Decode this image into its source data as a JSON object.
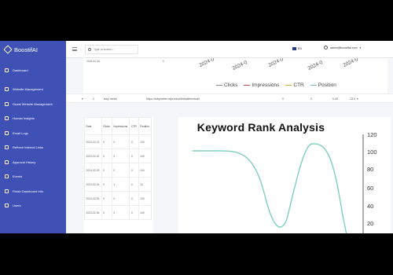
{
  "sidebar": {
    "brand": "BoostifAI",
    "items": [
      {
        "label": "Dashboard",
        "icon": "home-icon"
      },
      {
        "label": "Website Management",
        "icon": "globe-icon"
      },
      {
        "label": "Guest Website Management",
        "icon": "users-icon"
      },
      {
        "label": "Human Insights",
        "icon": "chart-icon"
      },
      {
        "label": "Email Logs",
        "icon": "mail-icon"
      },
      {
        "label": "Refresh Internal Links",
        "icon": "link-icon"
      },
      {
        "label": "Approval History",
        "icon": "check-icon"
      },
      {
        "label": "Events",
        "icon": "calendar-icon"
      },
      {
        "label": "Finish Dashboard Info",
        "icon": "info-icon"
      },
      {
        "label": "Users",
        "icon": "user-icon"
      }
    ]
  },
  "topbar": {
    "search_placeholder": "Type to search...",
    "language": "EN",
    "user_email": "admin@boostifai.com"
  },
  "top_table": {
    "rows": [
      {
        "date": "2024-02-06",
        "clicks": "0",
        "impressions": "0",
        "ctr": "0"
      }
    ]
  },
  "top_chart": {
    "x_ticks": [
      "2024-0",
      "2024-0",
      "2024-0",
      "2024-0",
      "2024-0"
    ],
    "legend": [
      {
        "name": "Clicks",
        "color": "#8a8a8a"
      },
      {
        "name": "Impressions",
        "color": "#c0504d"
      },
      {
        "name": "CTR",
        "color": "#c9b037"
      },
      {
        "name": "Position",
        "color": "#6cc5b0"
      }
    ]
  },
  "url_row": {
    "index": "2",
    "keyword": "toby meter",
    "url": "https://tobymeter.nl/product/betaalterminal/",
    "clicks": "0",
    "impressions": "2",
    "ctr": "0.00",
    "position": "13.0"
  },
  "data_table": {
    "headers": [
      "Date",
      "Clicks",
      "Impressions",
      "CTR",
      "Position"
    ],
    "rows": [
      [
        "2024-02-01",
        "0",
        "0",
        "0",
        "100"
      ],
      [
        "2024-02-02",
        "0",
        "0",
        "0",
        "100"
      ],
      [
        "2024-02-03",
        "0",
        "0",
        "0",
        "100"
      ],
      [
        "2024-02-04",
        "0",
        "1",
        "0",
        "13"
      ],
      [
        "2024-02-05",
        "0",
        "0",
        "0",
        "100"
      ],
      [
        "2024-02-06",
        "0",
        "0",
        "0",
        "100"
      ]
    ]
  },
  "rank_chart": {
    "title": "Keyword Rank Analysis",
    "y_ticks": [
      "120",
      "100",
      "80",
      "60",
      "40",
      "20"
    ],
    "line_color": "#7ecfc0"
  }
}
